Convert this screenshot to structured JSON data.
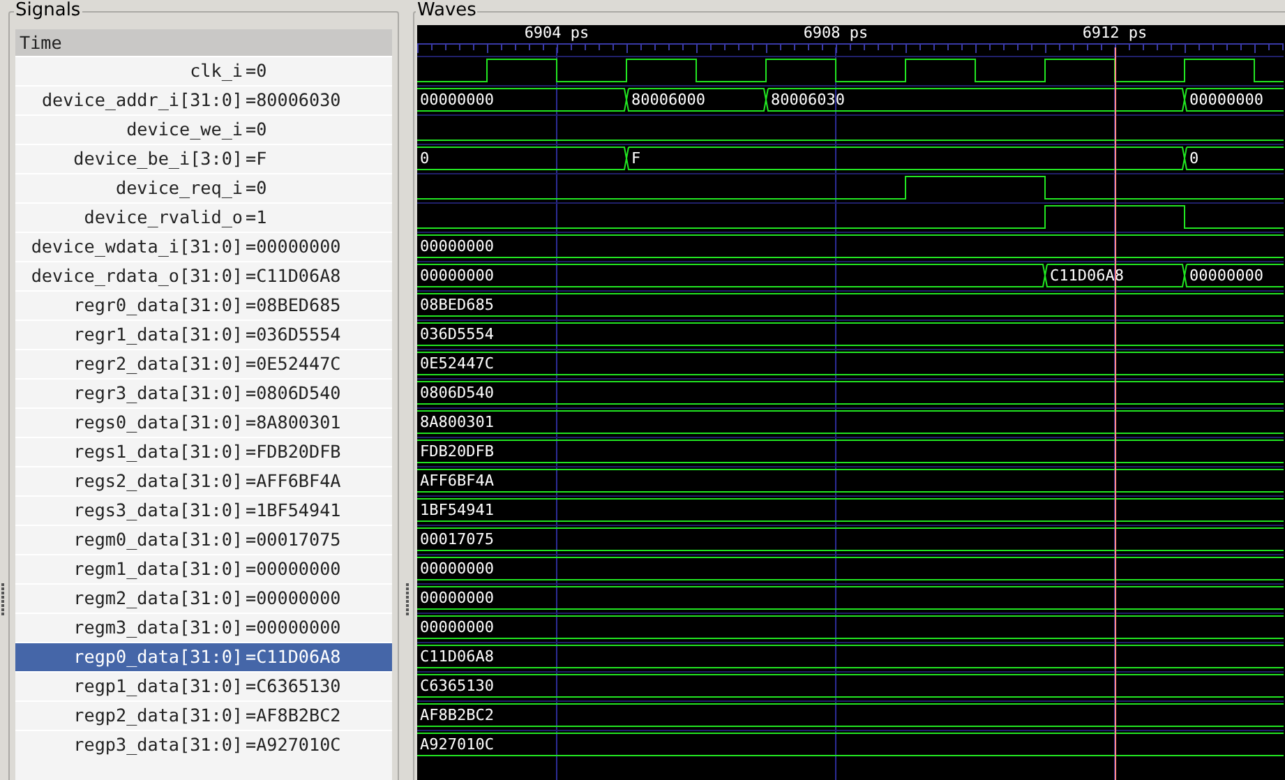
{
  "signals_panel": {
    "title": "Signals",
    "header": "Time"
  },
  "waves_panel": {
    "title": "Waves",
    "axis_labels": [
      "6904 ps",
      "6908 ps",
      "6912 ps"
    ]
  },
  "signals": [
    {
      "name": "clk_i",
      "value": "=0",
      "selected": false,
      "kind": "bit"
    },
    {
      "name": "device_addr_i[31:0]",
      "value": "=80006030",
      "selected": false,
      "kind": "bus",
      "wave_values": [
        "00000000",
        "80006000",
        "80006030",
        "00000000"
      ]
    },
    {
      "name": "device_we_i",
      "value": "=0",
      "selected": false,
      "kind": "bit"
    },
    {
      "name": "device_be_i[3:0]",
      "value": "=F",
      "selected": false,
      "kind": "bus",
      "wave_values": [
        "0",
        "F",
        "0"
      ]
    },
    {
      "name": "device_req_i",
      "value": "=0",
      "selected": false,
      "kind": "bit"
    },
    {
      "name": "device_rvalid_o",
      "value": "=1",
      "selected": false,
      "kind": "bit"
    },
    {
      "name": "device_wdata_i[31:0]",
      "value": "=00000000",
      "selected": false,
      "kind": "bus",
      "wave_values": [
        "00000000"
      ]
    },
    {
      "name": "device_rdata_o[31:0]",
      "value": "=C11D06A8",
      "selected": false,
      "kind": "bus",
      "wave_values": [
        "00000000",
        "C11D06A8",
        "00000000"
      ]
    },
    {
      "name": "regr0_data[31:0]",
      "value": "=08BED685",
      "selected": false,
      "kind": "bus",
      "wave_values": [
        "08BED685"
      ]
    },
    {
      "name": "regr1_data[31:0]",
      "value": "=036D5554",
      "selected": false,
      "kind": "bus",
      "wave_values": [
        "036D5554"
      ]
    },
    {
      "name": "regr2_data[31:0]",
      "value": "=0E52447C",
      "selected": false,
      "kind": "bus",
      "wave_values": [
        "0E52447C"
      ]
    },
    {
      "name": "regr3_data[31:0]",
      "value": "=0806D540",
      "selected": false,
      "kind": "bus",
      "wave_values": [
        "0806D540"
      ]
    },
    {
      "name": "regs0_data[31:0]",
      "value": "=8A800301",
      "selected": false,
      "kind": "bus",
      "wave_values": [
        "8A800301"
      ]
    },
    {
      "name": "regs1_data[31:0]",
      "value": "=FDB20DFB",
      "selected": false,
      "kind": "bus",
      "wave_values": [
        "FDB20DFB"
      ]
    },
    {
      "name": "regs2_data[31:0]",
      "value": "=AFF6BF4A",
      "selected": false,
      "kind": "bus",
      "wave_values": [
        "AFF6BF4A"
      ]
    },
    {
      "name": "regs3_data[31:0]",
      "value": "=1BF54941",
      "selected": false,
      "kind": "bus",
      "wave_values": [
        "1BF54941"
      ]
    },
    {
      "name": "regm0_data[31:0]",
      "value": "=00017075",
      "selected": false,
      "kind": "bus",
      "wave_values": [
        "00017075"
      ]
    },
    {
      "name": "regm1_data[31:0]",
      "value": "=00000000",
      "selected": false,
      "kind": "bus",
      "wave_values": [
        "00000000"
      ]
    },
    {
      "name": "regm2_data[31:0]",
      "value": "=00000000",
      "selected": false,
      "kind": "bus",
      "wave_values": [
        "00000000"
      ]
    },
    {
      "name": "regm3_data[31:0]",
      "value": "=00000000",
      "selected": false,
      "kind": "bus",
      "wave_values": [
        "00000000"
      ]
    },
    {
      "name": "regp0_data[31:0]",
      "value": "=C11D06A8",
      "selected": true,
      "kind": "bus",
      "wave_values": [
        "C11D06A8"
      ]
    },
    {
      "name": "regp1_data[31:0]",
      "value": "=C6365130",
      "selected": false,
      "kind": "bus",
      "wave_values": [
        "C6365130"
      ]
    },
    {
      "name": "regp2_data[31:0]",
      "value": "=AF8B2BC2",
      "selected": false,
      "kind": "bus",
      "wave_values": [
        "AF8B2BC2"
      ]
    },
    {
      "name": "regp3_data[31:0]",
      "value": "=A927010C",
      "selected": false,
      "kind": "bus",
      "wave_values": [
        "A927010C"
      ]
    }
  ]
}
